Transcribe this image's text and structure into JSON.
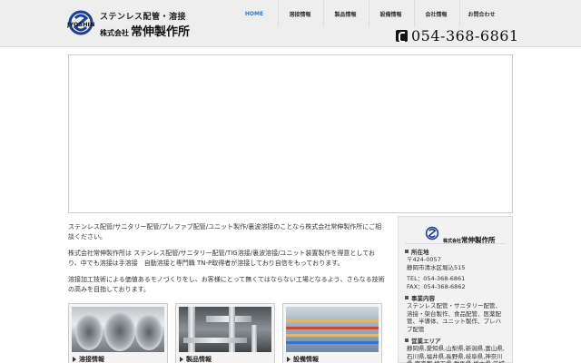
{
  "header": {
    "logo": {
      "mark_text": "JYOSHIN",
      "tagline": "ステンレス配管・溶接",
      "company_prefix": "株式会社",
      "company_name": "常伸製作所"
    },
    "nav": [
      {
        "label": "HOME",
        "active": true
      },
      {
        "label": "溶接情報",
        "active": false
      },
      {
        "label": "製品情報",
        "active": false
      },
      {
        "label": "設備情報",
        "active": false
      },
      {
        "label": "会社情報",
        "active": false
      },
      {
        "label": "お問合わせ",
        "active": false
      }
    ],
    "phone": "054-368-6861"
  },
  "main": {
    "paragraphs": [
      "ステンレス配管/サニタリー配管/プレファブ配管/ユニット製作/裏波溶接のことなら株式会社常伸製作所にご相談ください。",
      "株式会社常伸製作所は ステンレス配管/サニタリー配管/TIG溶接/裏波溶接/ユニット装置製作を得意としており、中でも溶接は手溶接　自動溶接と専門職 TN-P取得者が溶接しており自信をもっております。",
      "溶接加工技術による価値あるモノづくりをし、お客様にとって無くてはならない工場となるよう、さらなる技術の高みを目指しております。"
    ]
  },
  "cards": [
    {
      "title": "溶接情報"
    },
    {
      "title": "製品情報"
    },
    {
      "title": "設備情報"
    }
  ],
  "sidebar": {
    "logo": {
      "prefix": "株式会社",
      "name": "常伸製作所"
    },
    "address_head": "所在地",
    "postal": "〒424-0057",
    "address": "静岡市清水区堀込515",
    "tel": "TEL：054-368-6861",
    "fax": "FAX：054-368-6862",
    "business_head": "事業内容",
    "business": "ステンレス配管・サニタリー配管、溶接・架台製作、食品配管、医薬配管、半導体、ユニット製作、プレハブ配管",
    "area_head": "営業エリア",
    "area": "静岡県,愛知県,山梨県,新潟県,富山県,石川県,福井県,長野県,岐阜県,神奈川県,東京都,埼玉県,群馬県,栃木県,茨城県,千葉県"
  },
  "colors": {
    "header_bg": "#eeeeee",
    "nav_active": "#2a7bd0",
    "logo_mark": "#1f3f8f"
  }
}
